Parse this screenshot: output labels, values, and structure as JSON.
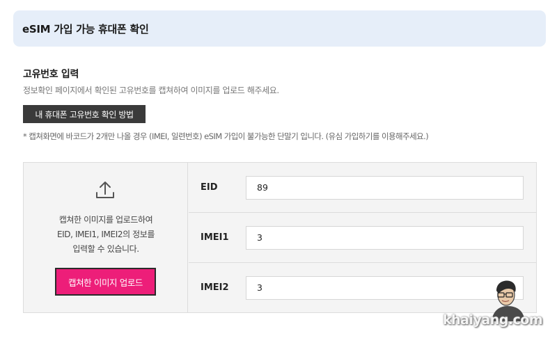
{
  "header": {
    "title": "eSIM 가입 가능 휴대폰 확인"
  },
  "section": {
    "title": "고유번호 입력",
    "description": "정보확인 페이지에서 확인된 고유번호를 캡쳐하여 이미지를 업로드 해주세요.",
    "guide_button_label": "내 휴대폰 고유번호 확인 방법",
    "note": "* 캡쳐화면에 바코드가 2개만 나올 경우 (IMEI, 일련번호) eSIM 가입이 불가능한 단말기 입니다. (유심 가입하기를 이용해주세요.)"
  },
  "upload": {
    "icon": "upload-icon",
    "text_lines": [
      "캡쳐한 이미지를 업로드하여",
      "EID, IMEI1, IMEI2의 정보를",
      "입력할 수 있습니다."
    ],
    "button_label": "캡쳐한 이미지 업로드"
  },
  "fields": [
    {
      "label": "EID",
      "value": "89"
    },
    {
      "label": "IMEI1",
      "value": "3"
    },
    {
      "label": "IMEI2",
      "value": "3"
    }
  ],
  "watermark": "khaiyang.com",
  "colors": {
    "accent": "#ed1e79",
    "header_bg": "#e6eef9",
    "guide_button_bg": "#3a3a3a"
  }
}
